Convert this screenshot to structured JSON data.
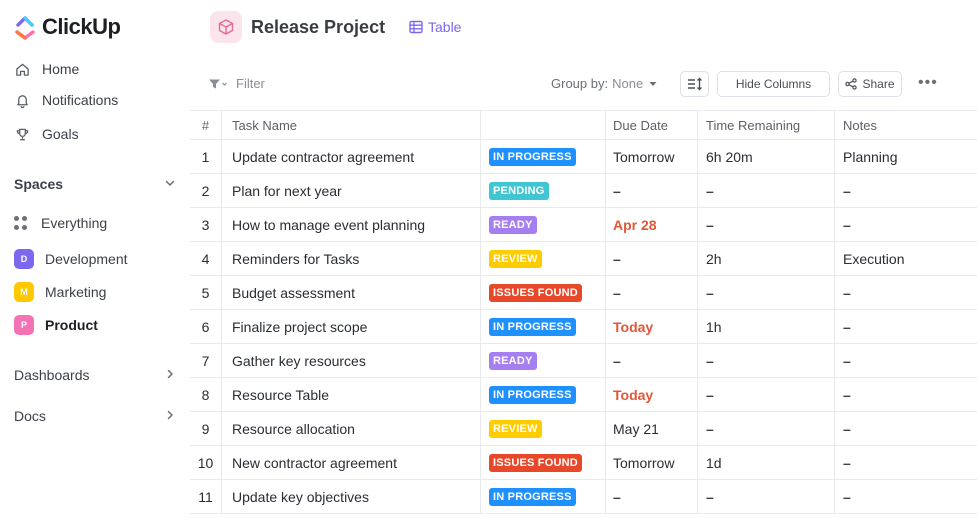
{
  "app": {
    "brand": "ClickUp",
    "colors": {
      "accent": "#7b68ee",
      "brand_pink": "#fd71af",
      "brand_blue": "#49ccf9"
    }
  },
  "sidebar": {
    "nav": [
      {
        "label": "Home",
        "icon": "home-icon"
      },
      {
        "label": "Notifications",
        "icon": "bell-icon"
      },
      {
        "label": "Goals",
        "icon": "trophy-icon"
      }
    ],
    "spaces_label": "Spaces",
    "everything_label": "Everything",
    "spaces": [
      {
        "letter": "D",
        "label": "Development",
        "color": "#7b68ee"
      },
      {
        "letter": "M",
        "label": "Marketing",
        "color": "#ffc800"
      },
      {
        "letter": "P",
        "label": "Product",
        "color": "#f472b6"
      }
    ],
    "dashboards_label": "Dashboards",
    "docs_label": "Docs"
  },
  "header": {
    "project_title": "Release Project",
    "view_label": "Table"
  },
  "toolbar": {
    "filter_label": "Filter",
    "groupby_label": "Group by:",
    "groupby_value": "None",
    "hide_columns_label": "Hide Columns",
    "share_label": "Share",
    "more_label": "•••"
  },
  "table": {
    "columns": [
      "#",
      "Task Name",
      "",
      "Due Date",
      "Time Remaining",
      "Notes"
    ],
    "status_colors": {
      "IN PROGRESS": "#1e90ff",
      "PENDING": "#3fc6d0",
      "READY": "#a57ef0",
      "REVIEW": "#ffcc00",
      "ISSUES FOUND": "#e8482a"
    },
    "rows": [
      {
        "num": "1",
        "name": "Update contractor agreement",
        "status": "IN PROGRESS",
        "due": "Tomorrow",
        "due_red": false,
        "time": "6h 20m",
        "notes": "Planning"
      },
      {
        "num": "2",
        "name": "Plan for next year",
        "status": "PENDING",
        "due": "–",
        "due_red": false,
        "time": "–",
        "notes": "–"
      },
      {
        "num": "3",
        "name": "How to manage event planning",
        "status": "READY",
        "due": "Apr 28",
        "due_red": true,
        "time": "–",
        "notes": "–"
      },
      {
        "num": "4",
        "name": "Reminders for Tasks",
        "status": "REVIEW",
        "due": "–",
        "due_red": false,
        "time": "2h",
        "notes": "Execution"
      },
      {
        "num": "5",
        "name": "Budget assessment",
        "status": "ISSUES FOUND",
        "due": "–",
        "due_red": false,
        "time": "–",
        "notes": "–"
      },
      {
        "num": "6",
        "name": "Finalize project  scope",
        "status": "IN PROGRESS",
        "due": "Today",
        "due_red": true,
        "time": "1h",
        "notes": "–"
      },
      {
        "num": "7",
        "name": "Gather key resources",
        "status": "READY",
        "due": "–",
        "due_red": false,
        "time": "–",
        "notes": "–"
      },
      {
        "num": "8",
        "name": "Resource Table",
        "status": "IN PROGRESS",
        "due": "Today",
        "due_red": true,
        "time": "–",
        "notes": "–"
      },
      {
        "num": "9",
        "name": "Resource allocation",
        "status": "REVIEW",
        "due": "May 21",
        "due_red": false,
        "time": "–",
        "notes": "–"
      },
      {
        "num": "10",
        "name": "New contractor agreement",
        "status": "ISSUES FOUND",
        "due": "Tomorrow",
        "due_red": false,
        "time": "1d",
        "notes": "–"
      },
      {
        "num": "11",
        "name": "Update key objectives",
        "status": "IN PROGRESS",
        "due": "–",
        "due_red": false,
        "time": "–",
        "notes": "–"
      }
    ]
  }
}
